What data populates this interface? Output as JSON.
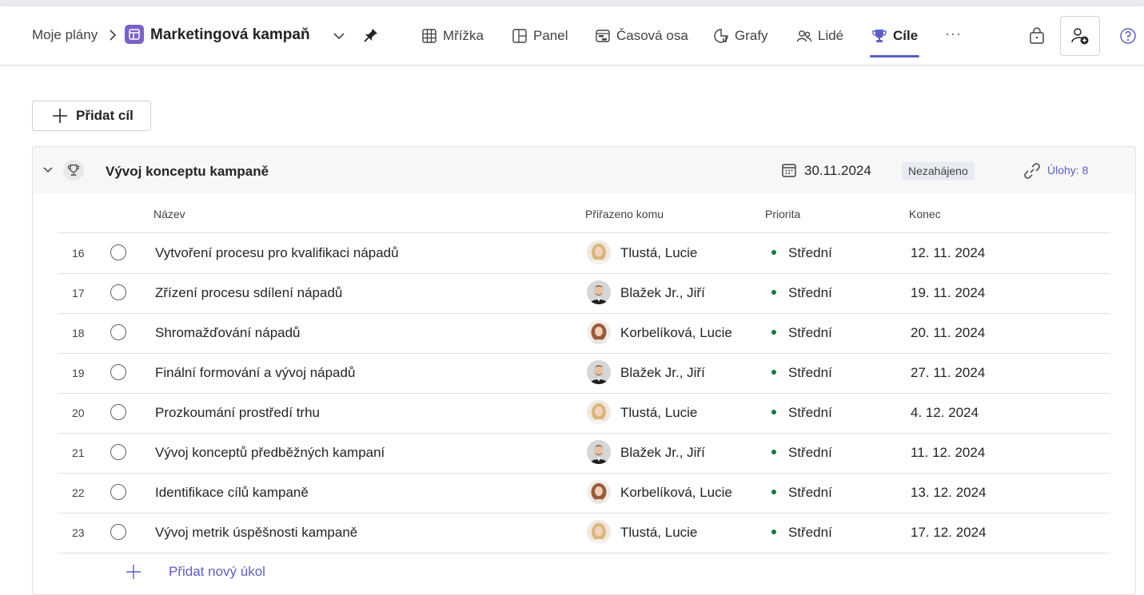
{
  "header": {
    "breadcrumb_parent": "Moje plány",
    "plan_title": "Marketingová kampaň",
    "tabs": [
      {
        "label": "Mřížka",
        "icon": "grid-icon",
        "active": false
      },
      {
        "label": "Panel",
        "icon": "board-icon",
        "active": false
      },
      {
        "label": "Časová osa",
        "icon": "timeline-icon",
        "active": false
      },
      {
        "label": "Grafy",
        "icon": "charts-icon",
        "active": false
      },
      {
        "label": "Lidé",
        "icon": "people-icon",
        "active": false
      },
      {
        "label": "Cíle",
        "icon": "trophy-icon",
        "active": true
      }
    ],
    "more_label": "···"
  },
  "toolbar": {
    "add_goal_label": "Přidat cíl"
  },
  "goal": {
    "title": "Vývoj konceptu kampaně",
    "due_date": "30.11.2024",
    "status": "Nezahájeno",
    "tasks_label": "Úlohy: 8"
  },
  "columns": {
    "name": "Název",
    "assigned": "Přiřazeno komu",
    "priority": "Priorita",
    "due": "Konec"
  },
  "rows": [
    {
      "num": "16",
      "name": "Vytvoření procesu pro kvalifikaci nápadů",
      "assignee": "Tlustá, Lucie",
      "avatar": "blonde",
      "priority": "Střední",
      "due": "12. 11. 2024"
    },
    {
      "num": "17",
      "name": "Zřízení procesu sdílení nápadů",
      "assignee": "Blažek Jr., Jiří",
      "avatar": "man",
      "priority": "Střední",
      "due": "19. 11. 2024"
    },
    {
      "num": "18",
      "name": "Shromažďování nápadů",
      "assignee": "Korbelíková, Lucie",
      "avatar": "brunette",
      "priority": "Střední",
      "due": "20. 11. 2024"
    },
    {
      "num": "19",
      "name": "Finální formování a vývoj nápadů",
      "assignee": "Blažek Jr., Jiří",
      "avatar": "man",
      "priority": "Střední",
      "due": "27. 11. 2024"
    },
    {
      "num": "20",
      "name": "Prozkoumání prostředí trhu",
      "assignee": "Tlustá, Lucie",
      "avatar": "blonde",
      "priority": "Střední",
      "due": "4. 12. 2024"
    },
    {
      "num": "21",
      "name": "Vývoj konceptů předběžných kampaní",
      "assignee": "Blažek Jr., Jiří",
      "avatar": "man",
      "priority": "Střední",
      "due": "11. 12. 2024"
    },
    {
      "num": "22",
      "name": "Identifikace cílů kampaně",
      "assignee": "Korbelíková, Lucie",
      "avatar": "brunette",
      "priority": "Střední",
      "due": "13. 12. 2024"
    },
    {
      "num": "23",
      "name": "Vývoj metrik úspěšnosti kampaně",
      "assignee": "Tlustá, Lucie",
      "avatar": "blonde",
      "priority": "Střední",
      "due": "17. 12. 2024"
    }
  ],
  "add_task_label": "Přidat nový úkol",
  "colors": {
    "accent": "#5b5fc7",
    "priority_medium": "#107c41",
    "plan_icon": "#7b61c8"
  }
}
